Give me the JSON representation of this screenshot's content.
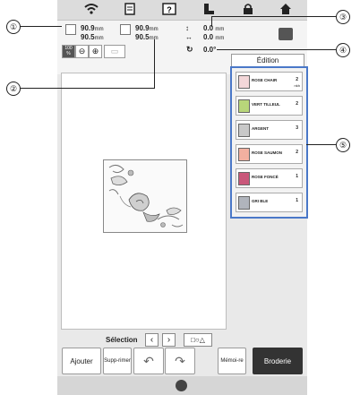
{
  "info": {
    "width_value": "90.9",
    "width_unit": "mm",
    "height_value": "90.5",
    "height_unit": "mm",
    "width2_value": "90.9",
    "width2_unit": "mm",
    "height2_value": "90.5",
    "height2_unit": "mm",
    "pos_y_value": "0.0",
    "pos_y_unit": "mm",
    "pos_x_value": "0.0",
    "pos_x_unit": "mm",
    "angle_value": "0.0°"
  },
  "zoom_label": "100 %",
  "edition_label": "Édition",
  "threads": [
    {
      "name": "ROSE CHAIR",
      "count": "2",
      "sub": "nkh"
    },
    {
      "name": "VERT TILLEUL",
      "count": "2",
      "sub": ""
    },
    {
      "name": "ARGENT",
      "count": "3",
      "sub": ""
    },
    {
      "name": "ROSE SAUMON",
      "count": "2",
      "sub": ""
    },
    {
      "name": "ROSE FONCÉ",
      "count": "1",
      "sub": ""
    },
    {
      "name": "GRI BLE",
      "count": "1",
      "sub": ""
    }
  ],
  "thread_colors": [
    "#f3d7d9",
    "#b8d67a",
    "#c8c8c8",
    "#f2b0a0",
    "#c9577a",
    "#b0b4bc"
  ],
  "selection_label": "Sélection",
  "buttons": {
    "add": "Ajouter",
    "delete": "Supp-rimer",
    "memory": "Mémoi-re",
    "embroidery": "Broderie"
  },
  "callouts": [
    "①",
    "②",
    "③",
    "④",
    "⑤"
  ]
}
